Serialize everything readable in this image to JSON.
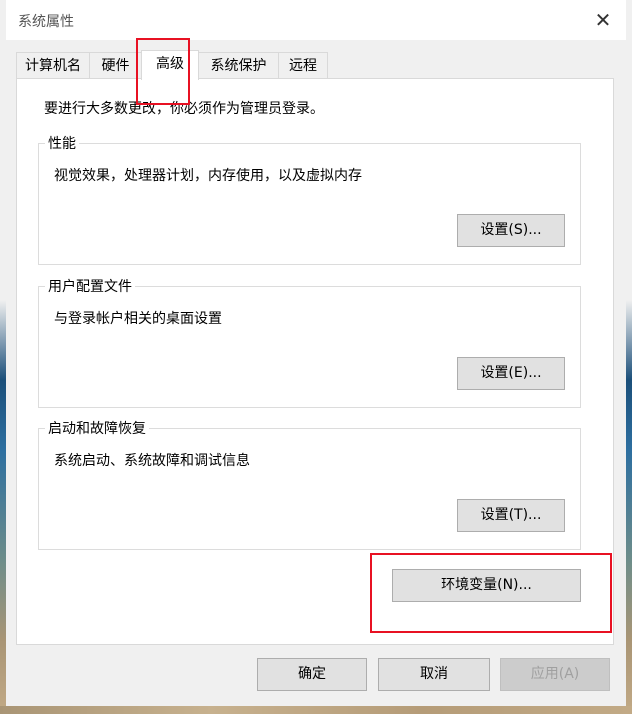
{
  "window": {
    "title": "系统属性"
  },
  "tabs": [
    {
      "label": "计算机名"
    },
    {
      "label": "硬件"
    },
    {
      "label": "高级",
      "active": true
    },
    {
      "label": "系统保护"
    },
    {
      "label": "远程"
    }
  ],
  "note": "要进行大多数更改，你必须作为管理员登录。",
  "groups": {
    "performance": {
      "title": "性能",
      "desc": "视觉效果，处理器计划，内存使用，以及虚拟内存",
      "button": "设置(S)..."
    },
    "profile": {
      "title": "用户配置文件",
      "desc": "与登录帐户相关的桌面设置",
      "button": "设置(E)..."
    },
    "startup": {
      "title": "启动和故障恢复",
      "desc": "系统启动、系统故障和调试信息",
      "button": "设置(T)..."
    }
  },
  "env_button": "环境变量(N)...",
  "footer": {
    "ok": "确定",
    "cancel": "取消",
    "apply": "应用(A)"
  },
  "colors": {
    "highlight": "#e81123"
  }
}
